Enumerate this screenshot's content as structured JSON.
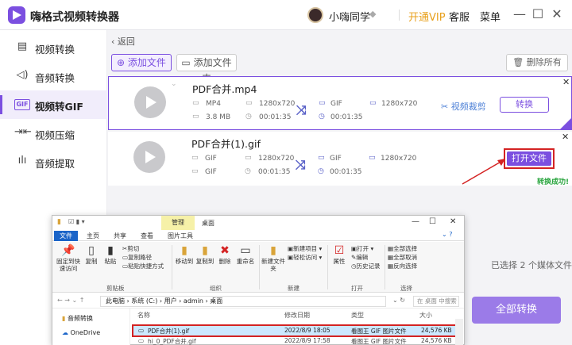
{
  "app": {
    "title": "嗨格式视频转换器",
    "user_name": "小嗨同学",
    "vip_label": "开通VIP",
    "service_label": "客服",
    "menu_label": "菜单",
    "window_minimize": "—",
    "window_maximize": "☐",
    "window_close": "✕"
  },
  "sidebar": {
    "items": [
      {
        "label": "视频转换",
        "icon": "film-icon"
      },
      {
        "label": "音频转换",
        "icon": "audio-icon"
      },
      {
        "label": "视频转GIF",
        "icon": "gif-icon",
        "active": true
      },
      {
        "label": "视频压缩",
        "icon": "compress-icon"
      },
      {
        "label": "音频提取",
        "icon": "waveform-icon"
      }
    ]
  },
  "toolbar": {
    "back_label": "返回",
    "add_file_label": "添加文件",
    "add_folder_label": "添加文件夹",
    "delete_all_label": "删除所有"
  },
  "files": [
    {
      "name": "PDF合并.mp4",
      "src_format": "MP4",
      "src_resolution": "1280x720",
      "src_size": "3.8 MB",
      "src_duration": "00:01:35",
      "dst_format": "GIF",
      "dst_resolution": "1280x720",
      "dst_duration": "00:01:35",
      "crop_label": "视频裁剪",
      "action_label": "转换"
    },
    {
      "name": "PDF合并(1).gif",
      "src_format": "GIF",
      "src_resolution": "1280x720",
      "src_size": "GIF",
      "src_duration": "00:01:35",
      "dst_format": "GIF",
      "dst_resolution": "1280x720",
      "dst_duration": "00:01:35",
      "action_label": "打开文件",
      "status": "转换成功!"
    }
  ],
  "footer": {
    "selected_text": "已选择 2 个媒体文件",
    "convert_all_label": "全部转换"
  },
  "explorer": {
    "manage_tab": "管理",
    "window_title": "桌面",
    "ribbon_tabs": [
      "文件",
      "主页",
      "共享",
      "查看",
      "图片工具"
    ],
    "clipboard": {
      "pin_label": "固定到快速访问",
      "copy_label": "复制",
      "paste_label": "粘贴",
      "cut_label": "剪切",
      "copy_path_label": "复制路径",
      "paste_shortcut_label": "粘贴快捷方式",
      "group_label": "剪贴板"
    },
    "organize": {
      "move_to": "移动到",
      "copy_to": "复制到",
      "delete": "删除",
      "rename": "重命名",
      "group_label": "组织"
    },
    "new": {
      "new_folder": "新建文件夹",
      "new_item": "新建项目",
      "easy_access": "轻松访问",
      "group_label": "新建"
    },
    "open": {
      "properties": "属性",
      "open": "打开",
      "edit": "编辑",
      "history": "历史记录",
      "group_label": "打开"
    },
    "select": {
      "select_all": "全部选择",
      "select_none": "全部取消",
      "invert": "反向选择",
      "group_label": "选择"
    },
    "breadcrumb": "此电脑 › 系统 (C:) › 用户 › admin › 桌面",
    "search_placeholder": "在 桌面 中搜索",
    "nav": [
      {
        "label": "音频转换"
      },
      {
        "label": "OneDrive"
      }
    ],
    "columns": [
      "名称",
      "修改日期",
      "类型",
      "大小"
    ],
    "rows": [
      {
        "name": "PDF合并(1).gif",
        "date": "2022/8/9 18:05",
        "type": "看图王 GIF 图片文件",
        "size": "24,576 KB"
      },
      {
        "name": "hi_0_PDF合并.gif",
        "date": "2022/8/9 17:58",
        "type": "看图王 GIF 图片文件",
        "size": "24,576 KB"
      }
    ]
  },
  "colors": {
    "accent": "#7b4fe0",
    "success": "#2aa53f",
    "highlight_red": "#d42323",
    "vip": "#e8a01c"
  }
}
